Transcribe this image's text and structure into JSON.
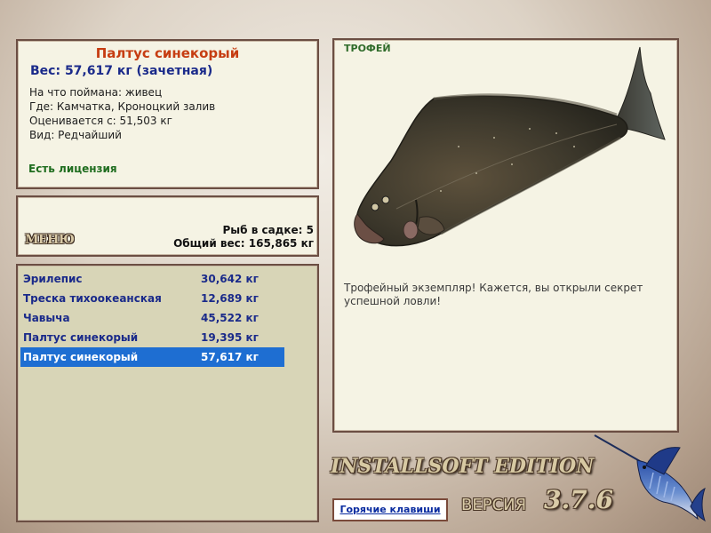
{
  "info": {
    "fish_name": "Палтус синекорый",
    "weight_line": "Вес: 57,617 кг (зачетная)",
    "bait_line": "На что поймана: живец",
    "place_line": "Где: Камчатка, Кроноцкий залив",
    "estimated_line": "Оценивается с: 51,503 кг",
    "kind_line": "Вид: Редчайший",
    "license": "Есть лицензия"
  },
  "menu": {
    "button_label": "МЕНЮ",
    "keepnet_count": "Рыб в садке: 5",
    "keepnet_total": "Общий вес: 165,865 кг"
  },
  "catch_list": [
    {
      "name": "Эрилепис",
      "weight": "30,642 кг"
    },
    {
      "name": "Треска тихоокеанская",
      "weight": "12,689 кг"
    },
    {
      "name": "Чавыча",
      "weight": "45,522 кг"
    },
    {
      "name": "Палтус синекорый",
      "weight": "19,395 кг"
    },
    {
      "name": "Палтус синекорый",
      "weight": "57,617 кг"
    }
  ],
  "selected_row": 4,
  "trophy": {
    "label": "ТРОФЕЙ",
    "text": "Трофейный экземпляр! Кажется, вы открыли секрет успешной ловли!"
  },
  "footer": {
    "hotkeys": "Горячие клавиши",
    "edition": "INSTALLSOFT EDITION",
    "version_label": "ВЕРСИЯ",
    "version_number": "3.7.6"
  },
  "colors": {
    "panel_bg": "#f5f3e4",
    "list_bg": "#d8d5b7",
    "selection": "#1e6ed2",
    "fish_name": "#c63d12",
    "weight": "#1a2a8a",
    "license": "#1f6d1f"
  },
  "icons": {
    "fish_picture": "halibut-image",
    "logo": "marlin-logo-icon"
  }
}
